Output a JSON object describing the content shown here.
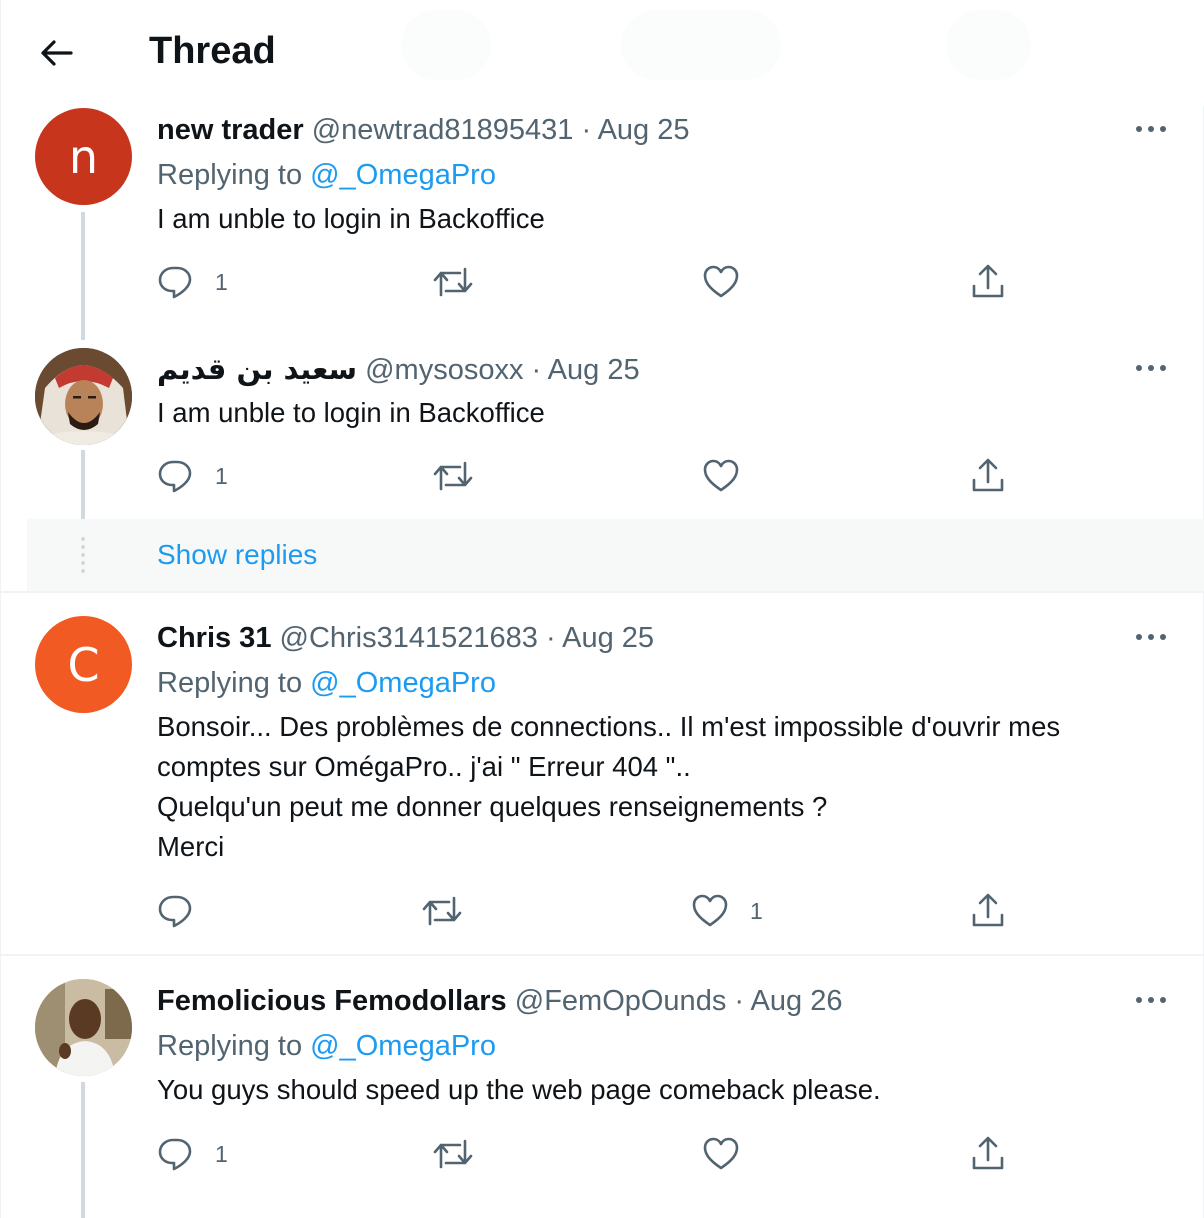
{
  "header": {
    "title": "Thread"
  },
  "colors": {
    "accent": "#1d9bf0",
    "muted": "#536471",
    "avatar_n": "#c6351c",
    "avatar_c": "#f15a22"
  },
  "tweets": [
    {
      "name": "new trader",
      "handle": "@newtrad81895431",
      "dot": "·",
      "date": "Aug 25",
      "replying_prefix": "Replying to",
      "replying_to": "@_OmegaPro",
      "text": "I am unble to login in Backoffice",
      "avatar_letter": "n",
      "reply_count": "1",
      "like_count": ""
    },
    {
      "name": "سعيد بن قديم",
      "handle": "@mysosoxx",
      "dot": "·",
      "date": "Aug 25",
      "text": "I am unble to login in Backoffice",
      "reply_count": "1",
      "like_count": ""
    },
    {
      "name": "Chris 31",
      "handle": "@Chris3141521683",
      "dot": "·",
      "date": "Aug 25",
      "replying_prefix": "Replying to",
      "replying_to": "@_OmegaPro",
      "text_lines": [
        "Bonsoir... Des problèmes de connections.. Il m'est impossible d'ouvrir mes",
        "comptes sur OmégaPro.. j'ai \" Erreur 404 \"..",
        "Quelqu'un peut me donner quelques renseignements ?",
        "Merci"
      ],
      "avatar_letter": "C",
      "reply_count": "",
      "like_count": "1"
    },
    {
      "name": "Femolicious Femodollars",
      "handle": "@FemOpOunds",
      "dot": "·",
      "date": "Aug 26",
      "replying_prefix": "Replying to",
      "replying_to": "@_OmegaPro",
      "text": "You guys should speed up the web page comeback please.",
      "reply_count": "1",
      "like_count": ""
    }
  ],
  "show_replies": "Show replies",
  "icons": [
    "back-arrow-icon",
    "more-icon",
    "reply-icon",
    "retweet-icon",
    "like-icon",
    "share-icon"
  ]
}
